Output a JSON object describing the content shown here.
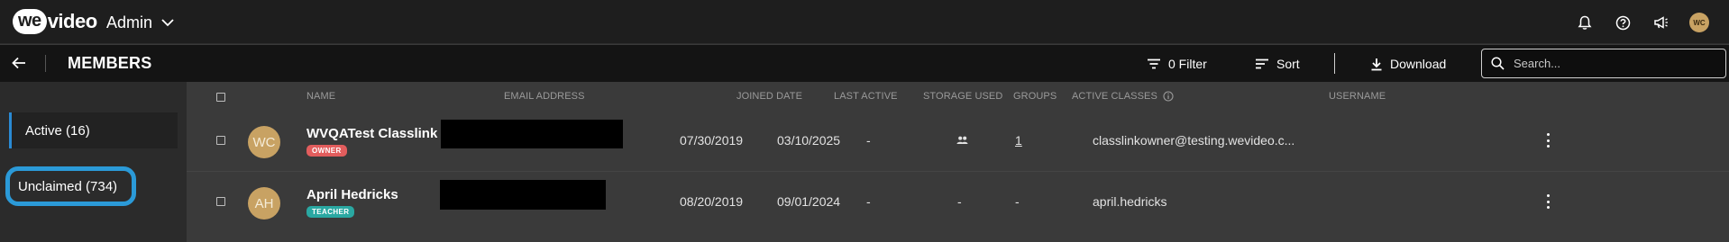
{
  "topbar": {
    "logo_we": "we",
    "logo_video": "video",
    "admin_label": "Admin",
    "avatar_initials": "WC"
  },
  "subbar": {
    "title": "MEMBERS",
    "filter_label": "0 Filter",
    "sort_label": "Sort",
    "download_label": "Download",
    "search_placeholder": "Search..."
  },
  "sidebar": {
    "items": [
      {
        "label": "Active (16)"
      },
      {
        "label": "Unclaimed (734)"
      }
    ]
  },
  "table": {
    "columns": [
      "NAME",
      "EMAIL ADDRESS",
      "JOINED DATE",
      "LAST ACTIVE",
      "STORAGE USED",
      "GROUPS",
      "ACTIVE CLASSES",
      "USERNAME"
    ],
    "rows": [
      {
        "initials": "WC",
        "name": "WVQATest Classlink",
        "role": "OWNER",
        "joined": "07/30/2019",
        "last_active": "03/10/2025",
        "storage": "-",
        "groups_icon": "groups-icon",
        "active_classes": "1",
        "username": "classlinkowner@testing.wevideo.c..."
      },
      {
        "initials": "AH",
        "name": "April Hedricks",
        "role": "TEACHER",
        "joined": "08/20/2019",
        "last_active": "09/01/2024",
        "storage": "-",
        "groups": "-",
        "active_classes": "-",
        "username": "april.hedricks"
      }
    ]
  },
  "colors": {
    "accent_blue": "#2b9ad8",
    "owner_badge": "#e25d5d",
    "teacher_badge": "#2aa8a2",
    "avatar": "#c8a263"
  }
}
